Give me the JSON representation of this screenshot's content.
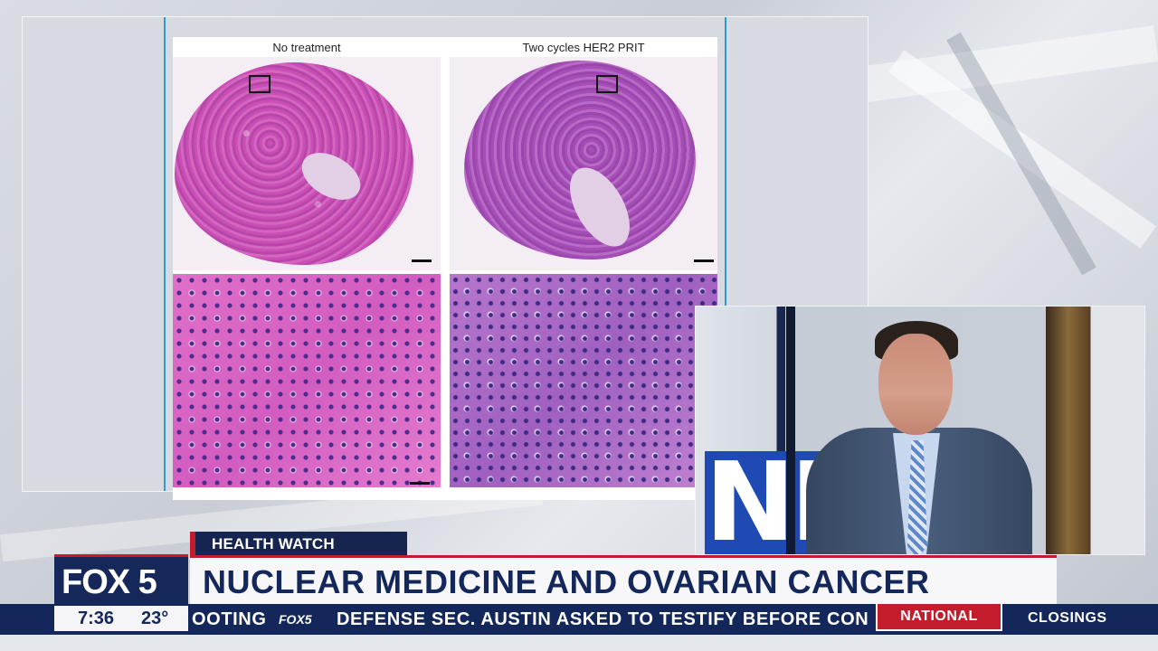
{
  "slide": {
    "panels": [
      {
        "title": "No treatment"
      },
      {
        "title": "Two cycles HER2 PRIT"
      }
    ]
  },
  "lower_third": {
    "category": "HEALTH WATCH",
    "headline": "NUCLEAR MEDICINE AND OVARIAN CANCER",
    "logo": "FOX 5"
  },
  "status": {
    "time": "7:36",
    "temperature": "23°"
  },
  "ticker": {
    "prev_text": "OOTING",
    "logo": "FOX5",
    "text": "DEFENSE SEC. AUSTIN ASKED TO TESTIFY BEFORE CON",
    "section": "NATIONAL",
    "next_section": "CLOSINGS"
  },
  "colors": {
    "brand_navy": "#14275a",
    "brand_red": "#c31c2c",
    "accent_blue": "#2d9ad6"
  }
}
